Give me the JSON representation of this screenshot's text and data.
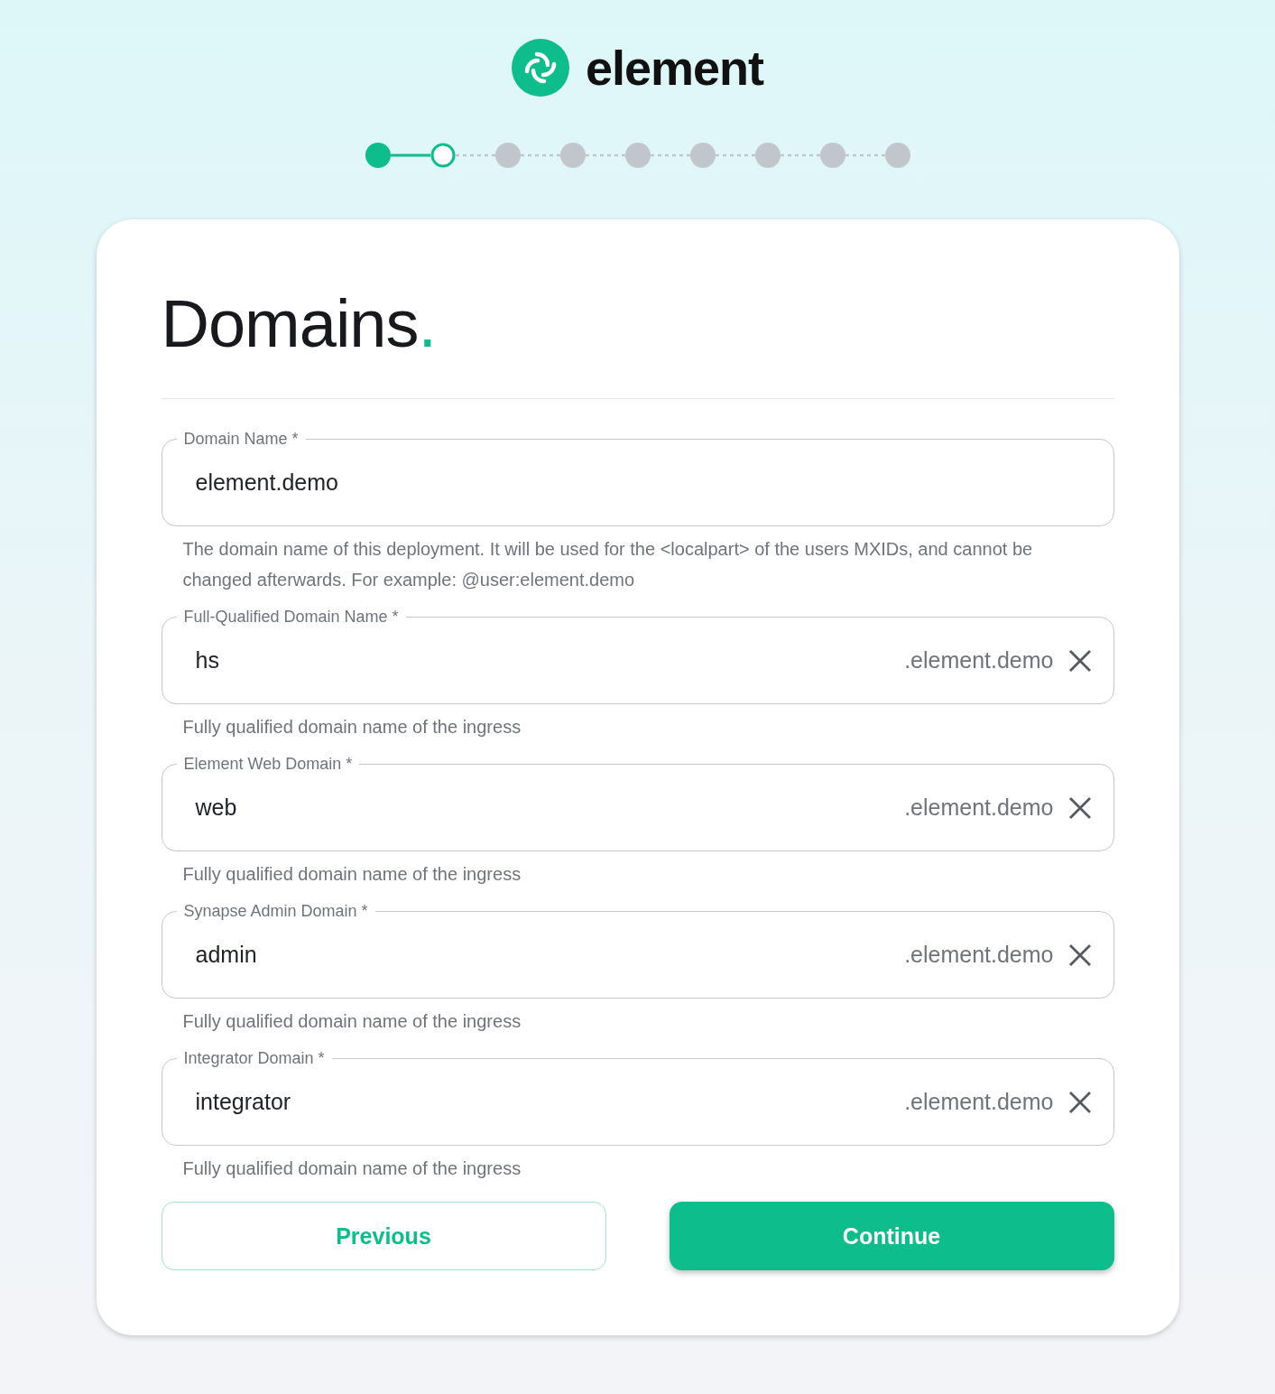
{
  "brand": {
    "name": "element"
  },
  "steps": [
    {
      "completed": true,
      "selected": false
    },
    {
      "completed": false,
      "selected": true
    },
    {
      "completed": false,
      "selected": false
    },
    {
      "completed": false,
      "selected": false
    },
    {
      "completed": false,
      "selected": false
    },
    {
      "completed": false,
      "selected": false
    },
    {
      "completed": false,
      "selected": false
    },
    {
      "completed": false,
      "selected": false
    },
    {
      "completed": false,
      "selected": false
    }
  ],
  "card": {
    "title": "Domains",
    "title_mark": ".",
    "fields": [
      {
        "label": "Domain Name *",
        "value": "element.demo",
        "clearable": false,
        "helper": "The domain name of this deployment. It will be used for the <localpart> of the users MXIDs, and cannot be changed afterwards. For example: @user:element.demo"
      },
      {
        "label": "Full-Qualified Domain Name *",
        "value": "hs",
        "suffix": ".element.demo",
        "clearable": true,
        "helper": "Fully qualified domain name of the ingress"
      },
      {
        "label": "Element Web Domain *",
        "value": "web",
        "suffix": ".element.demo",
        "clearable": true,
        "helper": "Fully qualified domain name of the ingress"
      },
      {
        "label": "Synapse Admin Domain *",
        "value": "admin",
        "suffix": ".element.demo",
        "clearable": true,
        "helper": "Fully qualified domain name of the ingress"
      },
      {
        "label": "Integrator Domain *",
        "value": "integrator",
        "suffix": ".element.demo",
        "clearable": true,
        "helper": "Fully qualified domain name of the ingress"
      }
    ],
    "buttons": [
      {
        "kind": "secondary",
        "label": "Previous"
      },
      {
        "kind": "primary",
        "label": "Continue"
      }
    ]
  }
}
